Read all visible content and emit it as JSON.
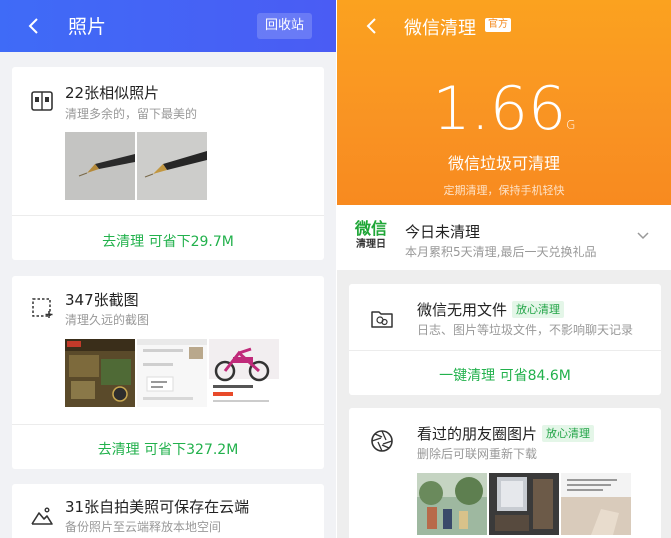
{
  "left": {
    "title": "照片",
    "recycle_label": "回收站",
    "cards": [
      {
        "icon": "similar-photos-icon",
        "title": "22张相似照片",
        "subtitle": "清理多余的，留下最美的",
        "action": "去清理 可省下29.7M"
      },
      {
        "icon": "screenshot-icon",
        "title": "347张截图",
        "subtitle": "清理久远的截图",
        "action": "去清理 可省下327.2M"
      },
      {
        "icon": "mountain-icon",
        "title": "31张自拍美照可保存在云端",
        "subtitle": "备份照片至云端释放本地空间"
      }
    ]
  },
  "right": {
    "title": "微信清理",
    "official_badge": "官方",
    "size_value": "1.66",
    "size_unit": "G",
    "size_desc": "微信垃圾可清理",
    "hint": "定期清理，保持手机轻快",
    "today": {
      "logo_line1": "微信",
      "logo_line2": "清理日",
      "title": "今日未清理",
      "subtitle": "本月累积5天清理,最后一天兑换礼品"
    },
    "cards": [
      {
        "icon": "wechat-folder-icon",
        "title": "微信无用文件",
        "tag": "放心清理",
        "subtitle": "日志、图片等垃圾文件，不影响聊天记录",
        "action": "一键清理 可省84.6M"
      },
      {
        "icon": "aperture-icon",
        "title": "看过的朋友圈图片",
        "tag": "放心清理",
        "subtitle": "删除后可联网重新下载"
      }
    ]
  },
  "colors": {
    "left_header": "#4062f6",
    "right_header": "#f9951f",
    "green_action": "#22b14c",
    "tag_bg": "#e4f6e8"
  }
}
